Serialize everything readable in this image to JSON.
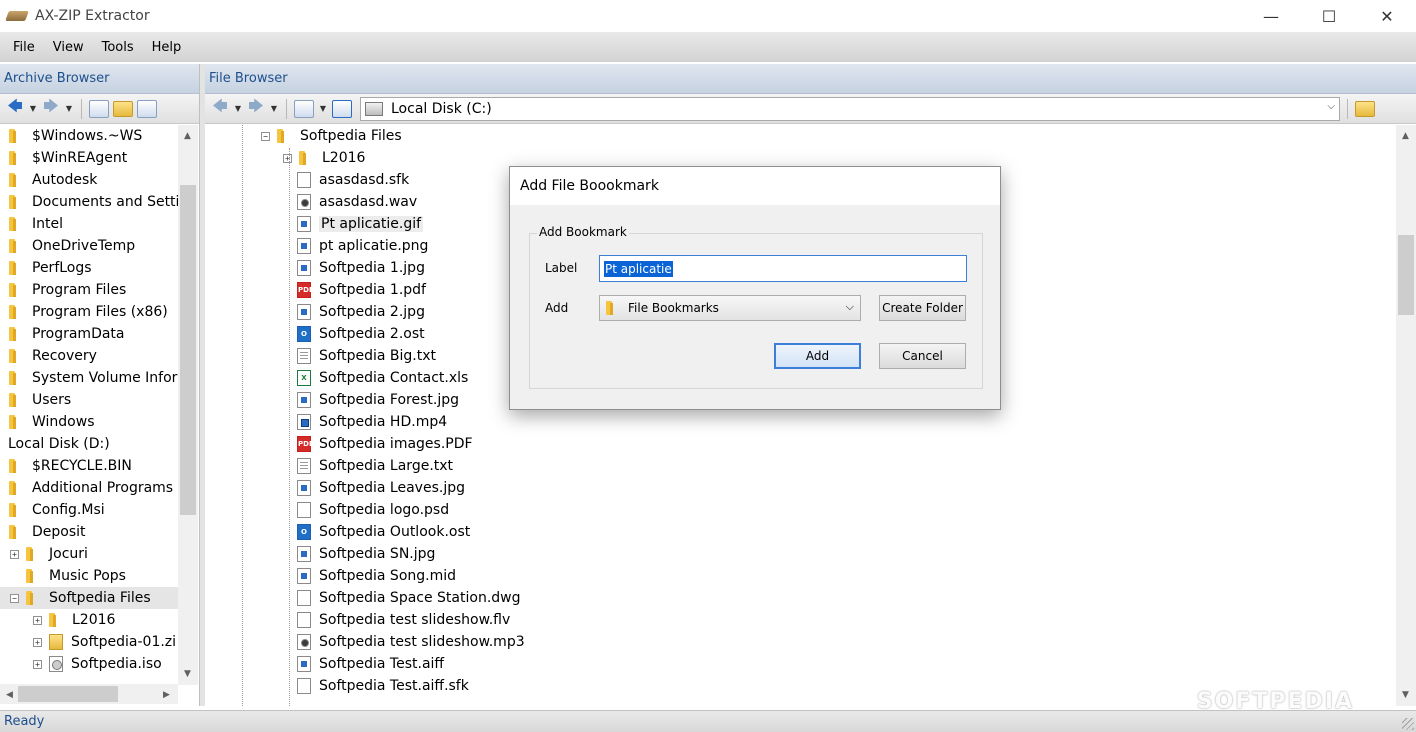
{
  "window": {
    "title": "AX-ZIP Extractor",
    "minimize_glyph": "—",
    "maximize_glyph": "☐",
    "close_glyph": "✕"
  },
  "menu": [
    "File",
    "View",
    "Tools",
    "Help"
  ],
  "archive_browser": {
    "title": "Archive Browser",
    "tree": [
      {
        "label": "$Windows.~WS",
        "indent": 0,
        "icon": "folder"
      },
      {
        "label": "$WinREAgent",
        "indent": 0,
        "icon": "folder"
      },
      {
        "label": "Autodesk",
        "indent": 0,
        "icon": "folder"
      },
      {
        "label": "Documents and Settin",
        "indent": 0,
        "icon": "folder"
      },
      {
        "label": "Intel",
        "indent": 0,
        "icon": "folder"
      },
      {
        "label": "OneDriveTemp",
        "indent": 0,
        "icon": "folder"
      },
      {
        "label": "PerfLogs",
        "indent": 0,
        "icon": "folder"
      },
      {
        "label": "Program Files",
        "indent": 0,
        "icon": "folder"
      },
      {
        "label": "Program Files (x86)",
        "indent": 0,
        "icon": "folder"
      },
      {
        "label": "ProgramData",
        "indent": 0,
        "icon": "folder"
      },
      {
        "label": "Recovery",
        "indent": 0,
        "icon": "folder"
      },
      {
        "label": "System Volume Inform",
        "indent": 0,
        "icon": "folder"
      },
      {
        "label": "Users",
        "indent": 0,
        "icon": "folder"
      },
      {
        "label": "Windows",
        "indent": 0,
        "icon": "folder"
      },
      {
        "label": "Local Disk (D:)",
        "indent": -1,
        "icon": "none"
      },
      {
        "label": "$RECYCLE.BIN",
        "indent": 0,
        "icon": "folder"
      },
      {
        "label": "Additional Programs",
        "indent": 0,
        "icon": "folder"
      },
      {
        "label": "Config.Msi",
        "indent": 0,
        "icon": "folder"
      },
      {
        "label": "Deposit",
        "indent": 0,
        "icon": "folder"
      },
      {
        "label": "Jocuri",
        "indent": 1,
        "icon": "folder",
        "expander": "+"
      },
      {
        "label": "Music Pops",
        "indent": 1,
        "icon": "folder"
      },
      {
        "label": "Softpedia Files",
        "indent": 1,
        "icon": "folder",
        "expander": "−",
        "selected": true
      },
      {
        "label": "L2016",
        "indent": 2,
        "icon": "folder",
        "expander": "+"
      },
      {
        "label": "Softpedia-01.zi",
        "indent": 2,
        "icon": "zip",
        "expander": "+"
      },
      {
        "label": "Softpedia.iso",
        "indent": 2,
        "icon": "iso",
        "expander": "+"
      }
    ]
  },
  "file_browser": {
    "title": "File Browser",
    "drive": "Local Disk (C:)",
    "root": {
      "label": "Softpedia Files",
      "expander": "−"
    },
    "items": [
      {
        "label": "L2016",
        "type": "folder",
        "expander": "+"
      },
      {
        "label": "asasdasd.sfk",
        "type": "blank"
      },
      {
        "label": "asasdasd.wav",
        "type": "audio"
      },
      {
        "label": "Pt aplicatie.gif",
        "type": "img",
        "highlight": true
      },
      {
        "label": "pt aplicatie.png",
        "type": "img"
      },
      {
        "label": "Softpedia 1.jpg",
        "type": "img"
      },
      {
        "label": "Softpedia 1.pdf",
        "type": "pdf"
      },
      {
        "label": "Softpedia 2.jpg",
        "type": "img"
      },
      {
        "label": "Softpedia 2.ost",
        "type": "outlook"
      },
      {
        "label": "Softpedia Big.txt",
        "type": "text"
      },
      {
        "label": "Softpedia Contact.xls",
        "type": "excel"
      },
      {
        "label": "Softpedia Forest.jpg",
        "type": "img"
      },
      {
        "label": "Softpedia HD.mp4",
        "type": "video"
      },
      {
        "label": "Softpedia images.PDF",
        "type": "pdf"
      },
      {
        "label": "Softpedia Large.txt",
        "type": "text"
      },
      {
        "label": "Softpedia Leaves.jpg",
        "type": "img"
      },
      {
        "label": "Softpedia logo.psd",
        "type": "blank"
      },
      {
        "label": "Softpedia Outlook.ost",
        "type": "outlook"
      },
      {
        "label": "Softpedia SN.jpg",
        "type": "img"
      },
      {
        "label": "Softpedia Song.mid",
        "type": "img"
      },
      {
        "label": "Softpedia Space Station.dwg",
        "type": "blank"
      },
      {
        "label": "Softpedia test slideshow.flv",
        "type": "blank"
      },
      {
        "label": "Softpedia test slideshow.mp3",
        "type": "audio"
      },
      {
        "label": "Softpedia Test.aiff",
        "type": "img"
      },
      {
        "label": "Softpedia Test.aiff.sfk",
        "type": "blank"
      }
    ]
  },
  "dialog": {
    "title": "Add File Boookmark",
    "group_title": "Add Bookmark",
    "label_caption": "Label",
    "label_value": "Pt aplicatie",
    "add_caption": "Add",
    "add_value": "File Bookmarks",
    "create_folder": "Create Folder",
    "ok": "Add",
    "cancel": "Cancel"
  },
  "status": "Ready",
  "watermark": "SOFTPEDIA",
  "file_type_badges": {
    "pdf": "PDF",
    "outlook": "O",
    "excel": "X"
  }
}
